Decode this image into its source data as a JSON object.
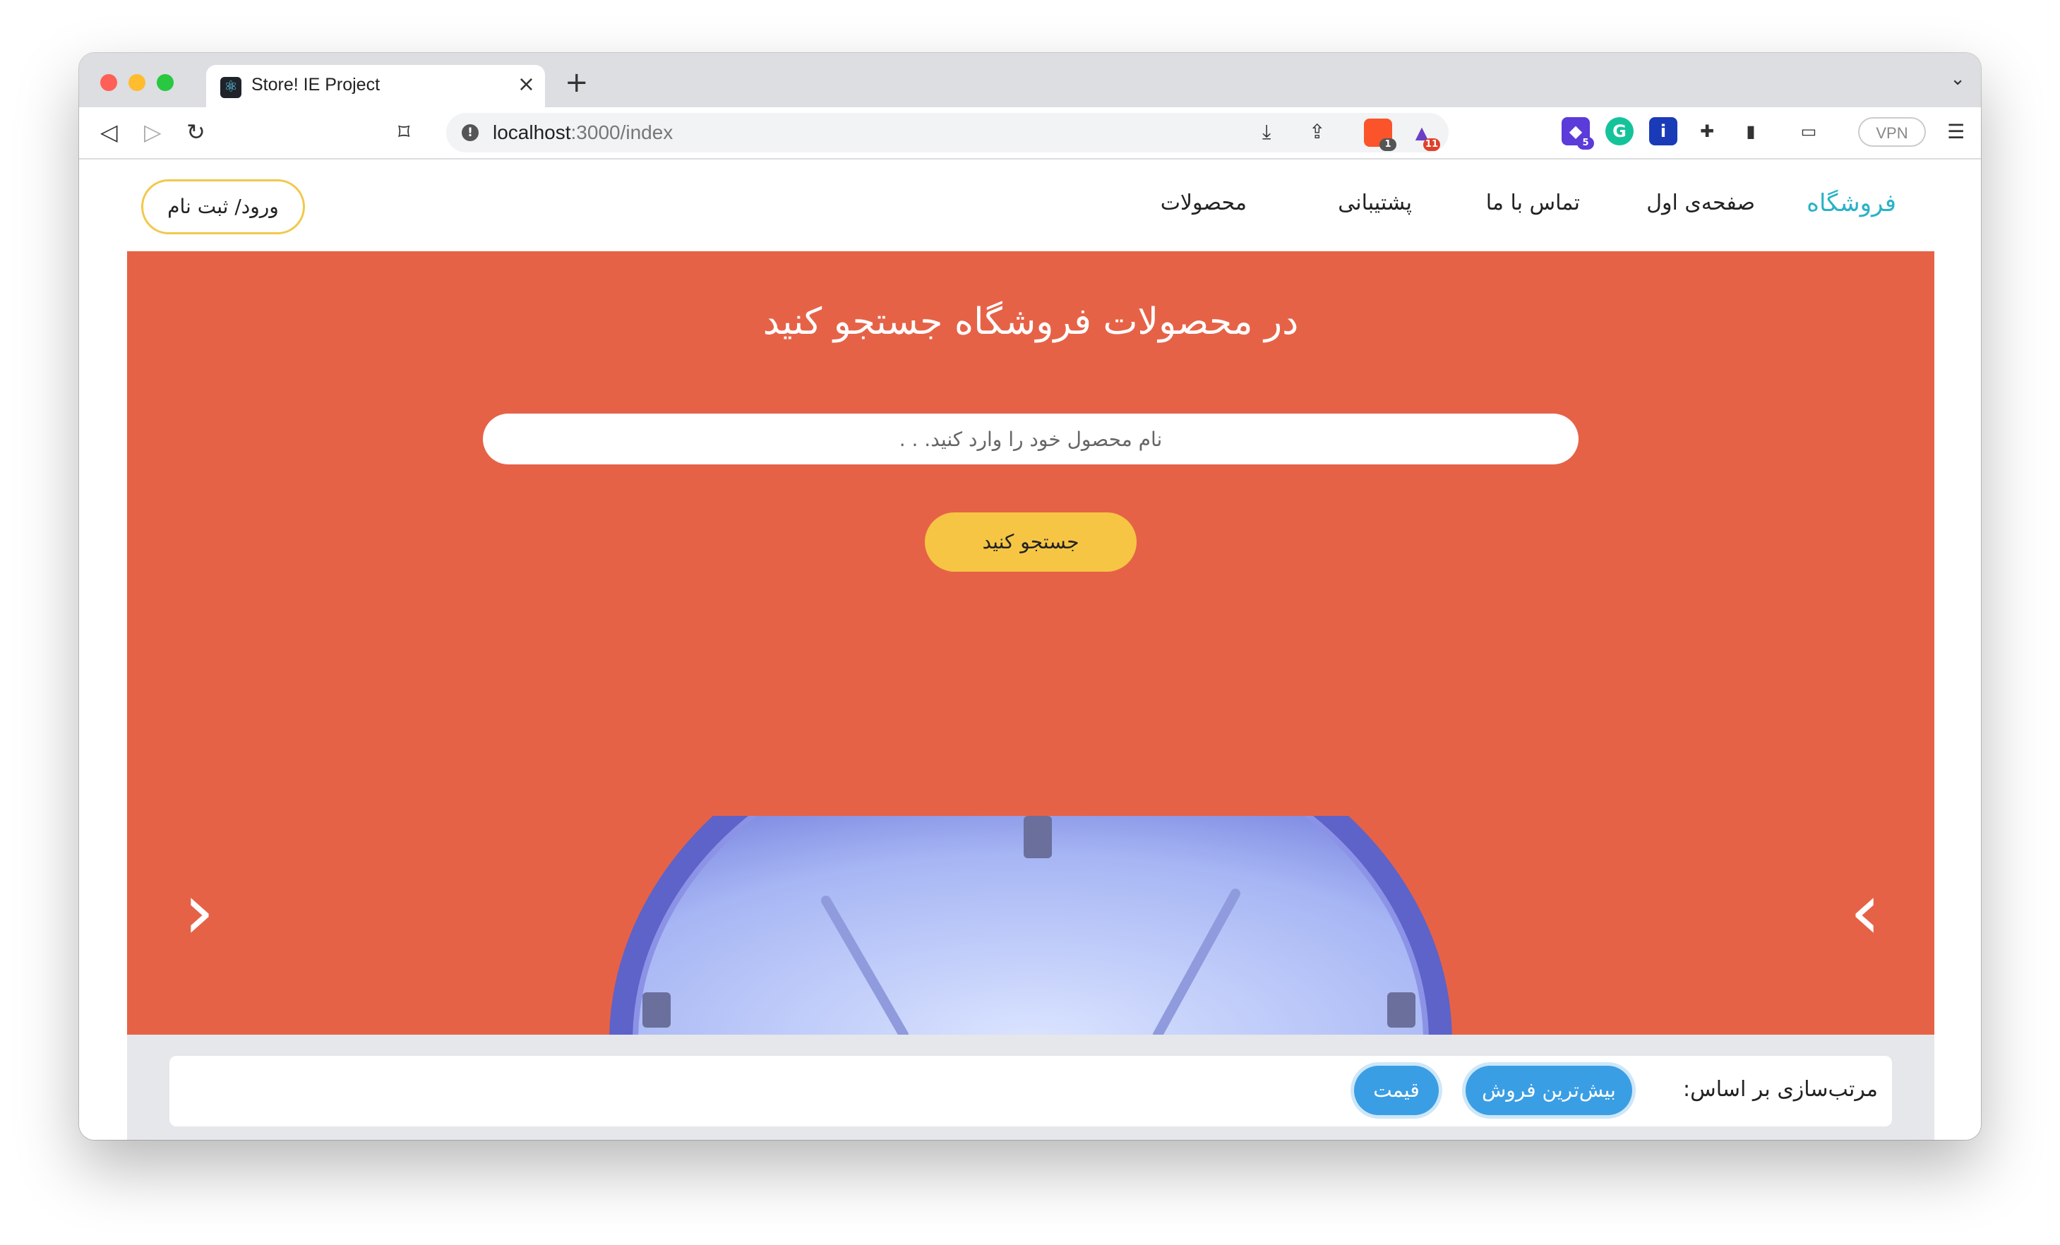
{
  "browser": {
    "tab_title": "Store! IE Project",
    "tab_close": "×",
    "new_tab": "+",
    "tab_menu": "⌄",
    "url_host": "localhost",
    "url_path": ":3000/index",
    "info_glyph": "!",
    "back_glyph": "◁",
    "forward_glyph": "▷",
    "reload_glyph": "↻",
    "bookmark_glyph": "⌑",
    "download_glyph": "⤓",
    "share_glyph": "⇪",
    "brave_badge": "1",
    "rewards_badge": "11",
    "ext_badge": "5",
    "grammarly_letter": "G",
    "ext_blue_letter": "i",
    "puzzle_glyph": "✚",
    "sidebar_glyph": "▮",
    "wallet_glyph": "▭",
    "vpn_label": "VPN",
    "menu_glyph": "☰",
    "favicon_glyph": "⚛"
  },
  "navbar": {
    "brand": "فروشگاه",
    "links": [
      "صفحه‌ی اول",
      "تماس با ما",
      "پشتیبانی",
      "محصولات"
    ],
    "login": "ورود/ ثبت نام"
  },
  "hero": {
    "title": "در محصولات فروشگاه جستجو کنید",
    "search_placeholder": "نام محصول خود را وارد کنید. . .",
    "search_value": "",
    "search_button": "جستجو کنید",
    "prev_arrow": "‹",
    "next_arrow": "›"
  },
  "sort": {
    "label": "مرتب‌سازی بر اساس:",
    "options": [
      "بیش‌ترین فروش",
      "قیمت"
    ]
  },
  "colors": {
    "accent": "#2ab2c8",
    "hero_bg": "#e66247",
    "button_yellow": "#f6c544",
    "chip_blue": "#3a9ee4"
  }
}
